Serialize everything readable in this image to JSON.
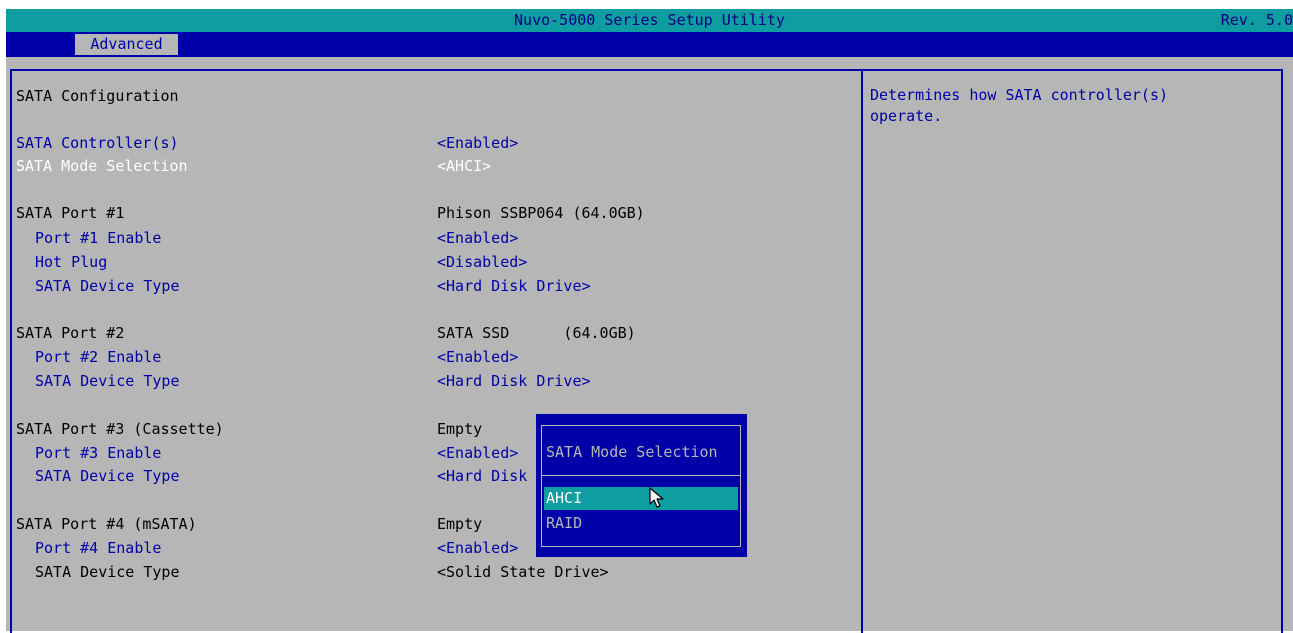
{
  "header": {
    "title": "Nuvo-5000 Series Setup Utility",
    "revision": "Rev. 5.0"
  },
  "tabs": [
    {
      "label": "Advanced",
      "active": true
    }
  ],
  "page": {
    "heading": "SATA Configuration",
    "rows": [
      {
        "label": "SATA Controller(s)",
        "value": "<Enabled>"
      },
      {
        "label": "SATA Mode Selection",
        "value": "<AHCI>",
        "selected": true
      },
      {
        "label": "SATA Port #1",
        "value": "Phison SSBP064 (64.0GB)"
      },
      {
        "label": "Port #1 Enable",
        "value": "<Enabled>"
      },
      {
        "label": "Hot Plug",
        "value": "<Disabled>"
      },
      {
        "label": "SATA Device Type",
        "value": "<Hard Disk Drive>"
      },
      {
        "label": "SATA Port #2",
        "value": "SATA SSD      (64.0GB)"
      },
      {
        "label": "Port #2 Enable",
        "value": "<Enabled>"
      },
      {
        "label": "SATA Device Type",
        "value": "<Hard Disk Drive>"
      },
      {
        "label": "SATA Port #3 (Cassette)",
        "value": "Empty"
      },
      {
        "label": "Port #3 Enable",
        "value": "<Enabled>"
      },
      {
        "label": "SATA Device Type",
        "value": "<Hard Disk"
      },
      {
        "label": "SATA Port #4 (mSATA)",
        "value": "Empty"
      },
      {
        "label": "Port #4 Enable",
        "value": "<Enabled>"
      },
      {
        "label": "SATA Device Type",
        "value": "<Solid State Drive>"
      }
    ]
  },
  "help": {
    "text": "Determines how SATA controller(s)\noperate."
  },
  "popup": {
    "title": "SATA Mode Selection",
    "options": [
      "AHCI",
      "RAID"
    ],
    "selected": "AHCI"
  },
  "colors": {
    "title_bar": "#0e9da0",
    "tab_bar": "#0000a8",
    "panel_bg": "#b6b6b6",
    "setting_text": "#0000a8",
    "highlight_text": "#ffffff",
    "highlight_bg": "#0e9da0"
  },
  "icons": {
    "cursor": "mouse-pointer-icon"
  }
}
